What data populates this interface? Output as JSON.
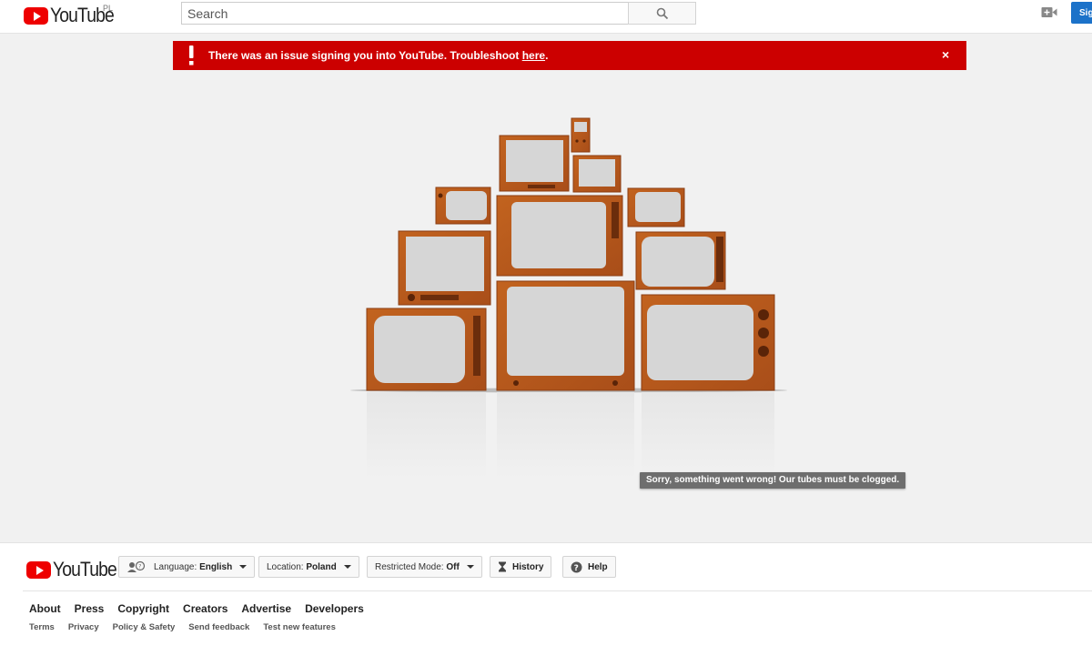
{
  "header": {
    "logo_text": "YouTube",
    "region": "PL",
    "search_placeholder": "Search",
    "sign_in_label": "Sig"
  },
  "alert": {
    "message": "There was an issue signing you into YouTube. Troubleshoot ",
    "link": "here",
    "period": ".",
    "close": "×"
  },
  "error": {
    "tooltip": "Sorry, something went wrong! Our tubes must be clogged."
  },
  "footer": {
    "logo_text": "YouTube",
    "language_label": "Language:",
    "language_value": "English",
    "location_label": "Location:",
    "location_value": "Poland",
    "restricted_label": "Restricted Mode:",
    "restricted_value": "Off",
    "history": "History",
    "help": "Help",
    "primary_links": [
      "About",
      "Press",
      "Copyright",
      "Creators",
      "Advertise",
      "Developers"
    ],
    "secondary_links": [
      "Terms",
      "Privacy",
      "Policy & Safety",
      "Send feedback",
      "Test new features"
    ]
  },
  "colors": {
    "brand_red": "#cc0000",
    "signin_blue": "#1c72c9",
    "wood": "#b8571e",
    "screen": "#d6d6d6"
  }
}
